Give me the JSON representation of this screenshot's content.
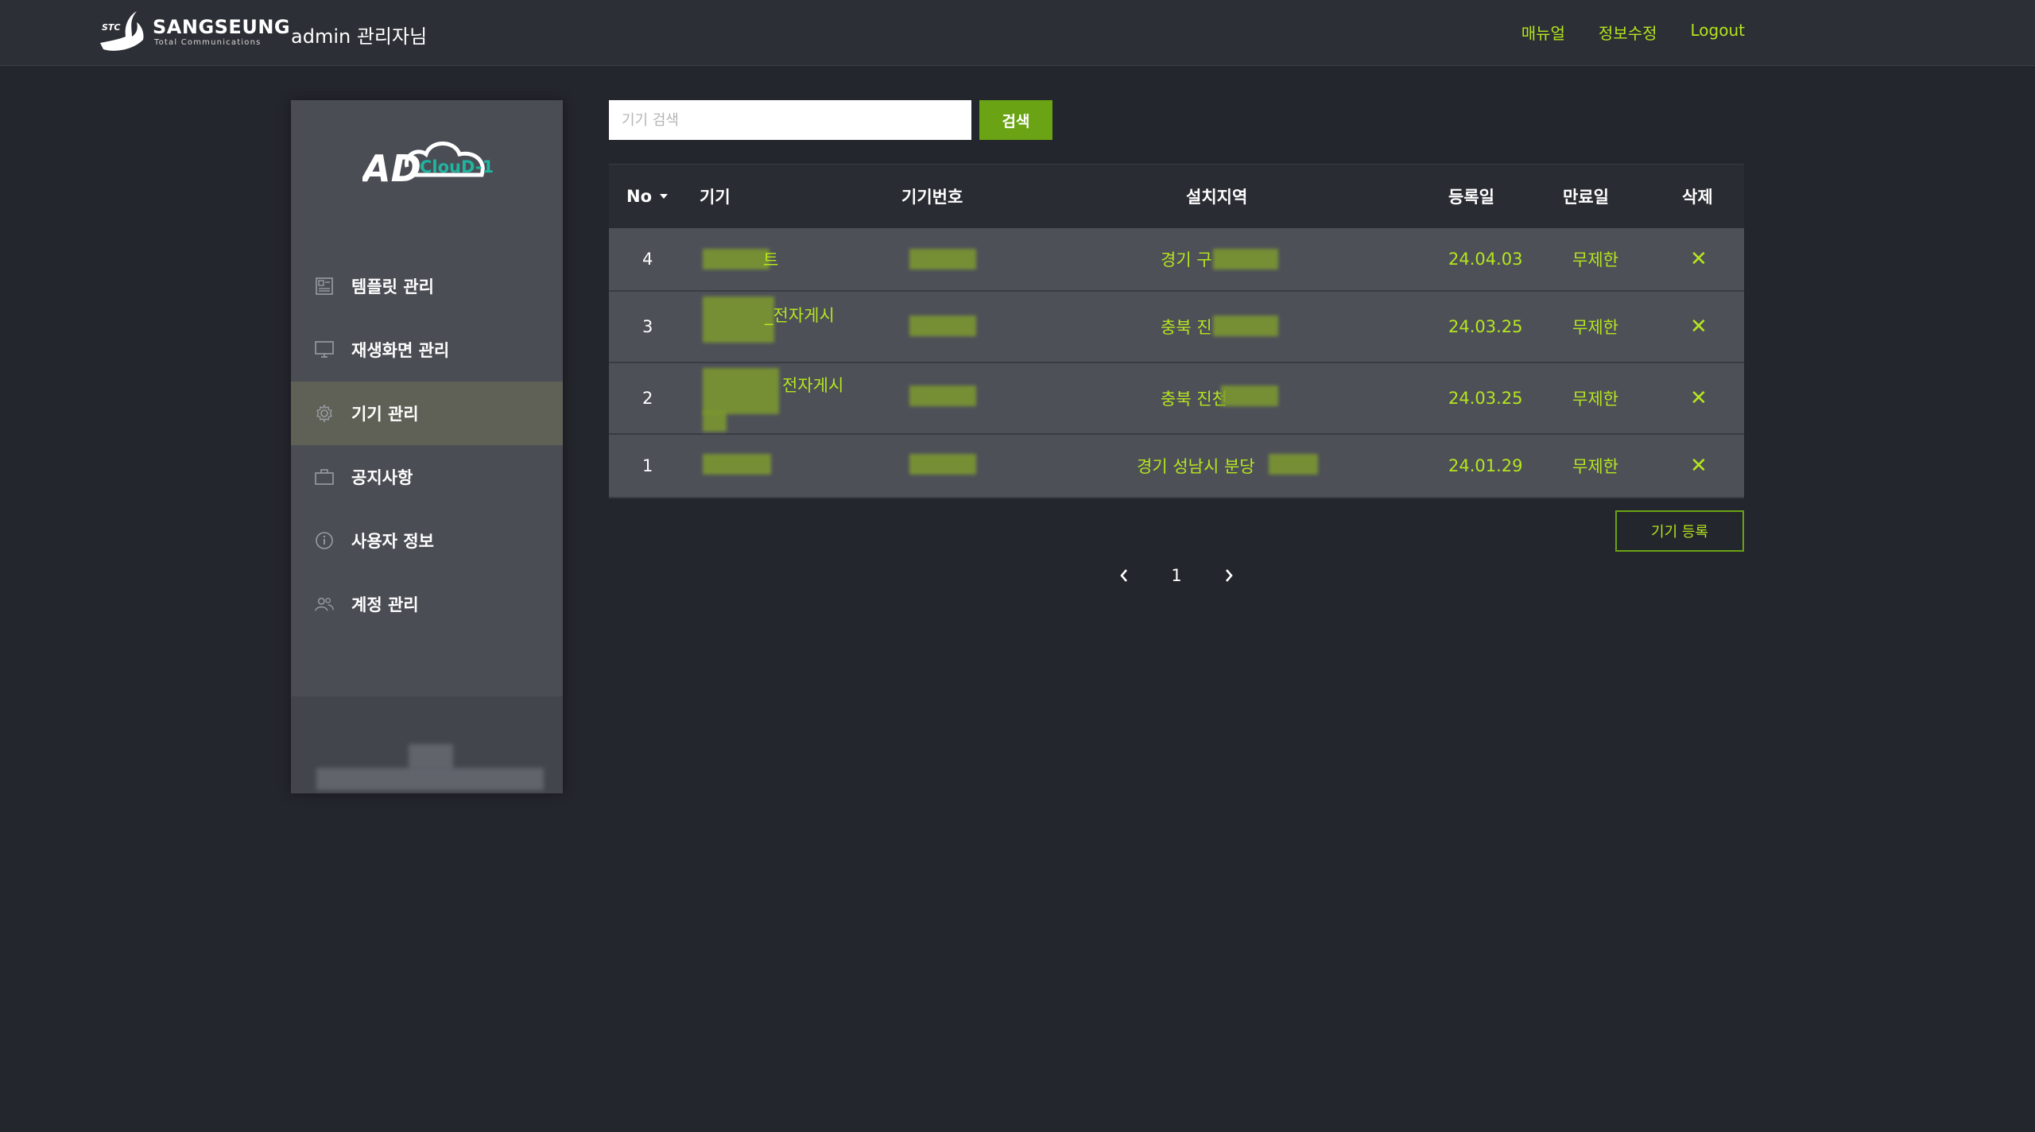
{
  "header": {
    "brand_name": "SANGSEUNG",
    "brand_sub": "Total Communications",
    "brand_mark": "STC",
    "admin_text": "admin 관리자님",
    "links": [
      "매뉴얼",
      "정보수정",
      "Logout"
    ]
  },
  "sidebar": {
    "logo_text": "AD",
    "logo_cloud_text": "ClouD-1",
    "items": [
      {
        "label": "템플릿 관리",
        "icon": "template-icon",
        "active": false
      },
      {
        "label": "재생화면 관리",
        "icon": "monitor-icon",
        "active": false
      },
      {
        "label": "기기 관리",
        "icon": "gear-icon",
        "active": true
      },
      {
        "label": "공지사항",
        "icon": "briefcase-icon",
        "active": false
      },
      {
        "label": "사용자 정보",
        "icon": "info-icon",
        "active": false
      },
      {
        "label": "계정 관리",
        "icon": "users-icon",
        "active": false
      }
    ]
  },
  "search": {
    "placeholder": "기기 검색",
    "button_label": "검색"
  },
  "table": {
    "columns": [
      "No",
      "기기",
      "기기번호",
      "설치지역",
      "등록일",
      "만료일",
      "삭제"
    ],
    "rows": [
      {
        "no": "4",
        "device": "트",
        "region": "경기 구",
        "registered": "24.04.03",
        "expires": "무제한",
        "delete": "✕"
      },
      {
        "no": "3",
        "device": "_전자게시",
        "region": "충북 진",
        "registered": "24.03.25",
        "expires": "무제한",
        "delete": "✕"
      },
      {
        "no": "2",
        "device": "전자게시",
        "region": "충북 진천",
        "registered": "24.03.25",
        "expires": "무제한",
        "delete": "✕"
      },
      {
        "no": "1",
        "device": "",
        "region": "경기 성남시 분당",
        "registered": "24.01.29",
        "expires": "무제한",
        "delete": "✕"
      }
    ]
  },
  "register_button": "기기 등록",
  "pagination": {
    "current": "1"
  },
  "colors": {
    "accent": "#b5e61d",
    "button": "#6aa313",
    "background": "#24262d"
  }
}
